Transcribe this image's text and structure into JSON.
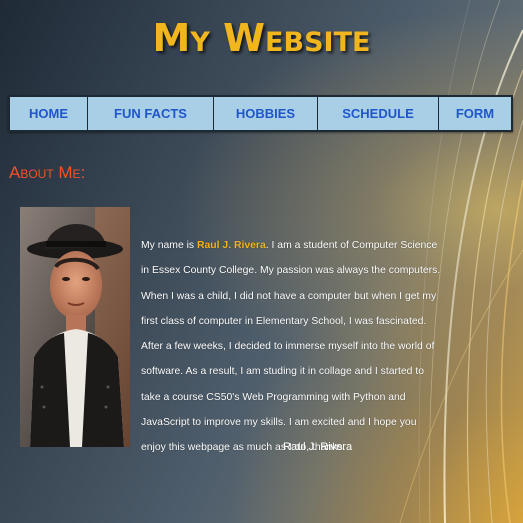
{
  "header": {
    "title": "My Website",
    "title_color": "#f1b51d"
  },
  "nav": {
    "background_color": "#a9cfe6",
    "link_color": "#1f56c9",
    "items": [
      {
        "label": "HOME"
      },
      {
        "label": "FUN FACTS"
      },
      {
        "label": "HOBBIES"
      },
      {
        "label": "SCHEDULE"
      },
      {
        "label": "FORM"
      }
    ]
  },
  "about": {
    "heading": "About Me:",
    "heading_color": "#f0522c",
    "bio_intro": "My name is ",
    "bio_name": "Raul J. Rivera",
    "bio_rest": ". I am a student of Computer Science in Essex County College. My passion was always the computers. When I was a child, I did not have a computer but when I get my first class of computer in Elementary School, I was fascinated. After a few weeks, I decided to immerse myself into the world of software. As a result, I am studing it in collage and I started to take a course CS50's Web Programming with Python and JavaScript to improve my skills. I am excited and I hope you enjoy this webpage as much as I do, thanks.",
    "signature": "Raul J. Rivera",
    "photo_icon": "profile-photo"
  }
}
